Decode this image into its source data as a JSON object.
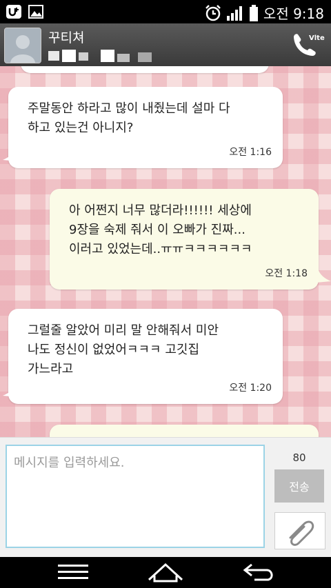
{
  "status_bar": {
    "time": "오전 9:18",
    "icons": [
      "u-plus-logo-icon",
      "gallery-icon",
      "alarm-icon",
      "signal-icon",
      "battery-icon"
    ]
  },
  "header": {
    "contact_name": "꾸티쳐",
    "call_icon": "phone-lte-icon",
    "call_label": "Vlte"
  },
  "messages": [
    {
      "direction": "in",
      "text": "주말동안 하라고 많이 내줬는데 설마 다\n하고 있는건 아니지?",
      "time": "오전 1:16"
    },
    {
      "direction": "out",
      "text": "아 어쩐지 너무 많더라!!!!!! 세상에\n9장을 숙제 줘서 이 오빠가 진짜...\n이러고 있었는데..ㅠㅠㅋㅋㅋㅋㅋㅋ",
      "time": "오전 1:18"
    },
    {
      "direction": "in",
      "text": "그럴줄 알았어 미리 말 안해줘서 미안\n나도 정신이 없었어ㅋㅋㅋ 고깃집\n가느라고",
      "time": "오전 1:20"
    }
  ],
  "composer": {
    "placeholder": "메시지를 입력하세요.",
    "char_count": "80",
    "send_label": "전송",
    "attach_icon": "paperclip-icon"
  },
  "nav_bar": {
    "icons": [
      "menu-icon",
      "home-icon",
      "back-icon"
    ]
  },
  "colors": {
    "chat_bg": "#f7dede",
    "incoming_bubble": "#ffffff",
    "outgoing_bubble": "#fbfbe7",
    "input_border": "#9bd3e6"
  }
}
